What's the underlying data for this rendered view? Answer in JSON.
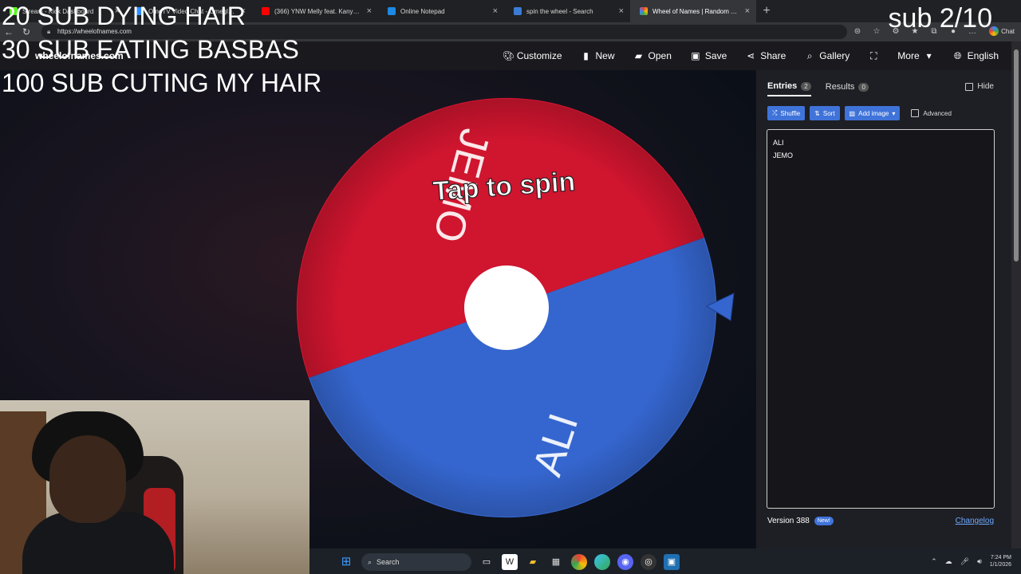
{
  "browser": {
    "tabs": [
      {
        "label": "Stream - Kick Dashboard",
        "favicon_color": "#53fc18"
      },
      {
        "label": "OmeTV Video Chat - Omegle R...",
        "favicon_color": "#2d8cff"
      },
      {
        "label": "(366) YNW Melly feat. Kanye West",
        "favicon_color": "#ff0000"
      },
      {
        "label": "Online Notepad",
        "favicon_color": "#1e88e5"
      },
      {
        "label": "spin the wheel - Search",
        "favicon_color": "#3a7bd5"
      },
      {
        "label": "Wheel of Names | Random name ...",
        "favicon_color": "#34a853",
        "active": true
      }
    ],
    "url": "https://wheelofnames.com",
    "chat_label": "Chat"
  },
  "site": {
    "logo": "wheelofnames.com",
    "menu": [
      {
        "label": "Customize",
        "icon": "palette-icon"
      },
      {
        "label": "New",
        "icon": "file-icon"
      },
      {
        "label": "Open",
        "icon": "folder-icon"
      },
      {
        "label": "Save",
        "icon": "save-icon"
      },
      {
        "label": "Share",
        "icon": "share-icon"
      },
      {
        "label": "Gallery",
        "icon": "search-icon"
      },
      {
        "label": "",
        "icon": "fullscreen-icon"
      },
      {
        "label": "More",
        "icon": "chevron-down-icon"
      },
      {
        "label": "English",
        "icon": "globe-icon"
      }
    ]
  },
  "wheel": {
    "center_text": "Tap to spin",
    "segments": [
      {
        "label": "JEMO",
        "color": "#d0152f"
      },
      {
        "label": "ALI",
        "color": "#3566cf"
      }
    ],
    "pointer_color": "#3566cf"
  },
  "sidebar": {
    "entries_tab": "Entries",
    "entries_count": "2",
    "results_tab": "Results",
    "results_count": "0",
    "hide_label": "Hide",
    "shuffle_label": "Shuffle",
    "sort_label": "Sort",
    "add_image_label": "Add image",
    "advanced_label": "Advanced",
    "entries": [
      "ALI",
      "JEMO"
    ],
    "version": "Version 388",
    "new_badge": "New!",
    "changelog": "Changelog"
  },
  "taskbar": {
    "search_label": "Search",
    "time": "7:24 PM",
    "date": "1/1/2026"
  },
  "overlays": {
    "line1": "20 SUB DYING HAIR",
    "line2": "30 SUB EATING BASBAS",
    "line3": "100 SUB CUTING MY HAIR",
    "goal": "sub 2/10"
  }
}
